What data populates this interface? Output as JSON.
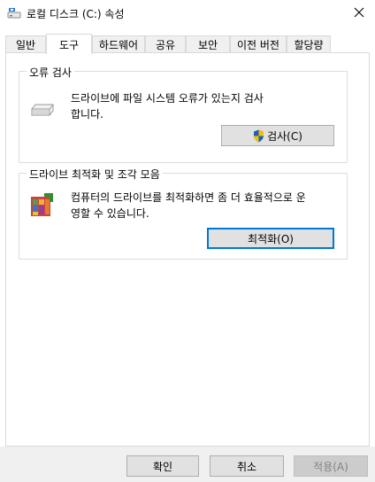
{
  "window": {
    "title": "로컬 디스크 (C:) 속성",
    "icon": "drive-icon",
    "close_icon": "close-icon"
  },
  "tabs": [
    {
      "label": "일반",
      "active": false
    },
    {
      "label": "도구",
      "active": true
    },
    {
      "label": "하드웨어",
      "active": false
    },
    {
      "label": "공유",
      "active": false
    },
    {
      "label": "보안",
      "active": false
    },
    {
      "label": "이전 버전",
      "active": false
    },
    {
      "label": "할당량",
      "active": false
    }
  ],
  "error_check": {
    "title": "오류 검사",
    "line1": "드라이브에 파일 시스템 오류가 있는지 검사",
    "line2": "합니다.",
    "button": "검사(C)",
    "icon": "hard-drive-icon",
    "button_icon": "shield-icon"
  },
  "optimize": {
    "title": "드라이브 최적화 및 조각 모음",
    "line1": "컴퓨터의 드라이브를 최적화하면 좀 더 효율적으로 운",
    "line2": "영할 수 있습니다.",
    "button": "최적화(O)",
    "icon": "defrag-icon"
  },
  "footer": {
    "ok": "확인",
    "cancel": "취소",
    "apply": "적용(A)"
  }
}
